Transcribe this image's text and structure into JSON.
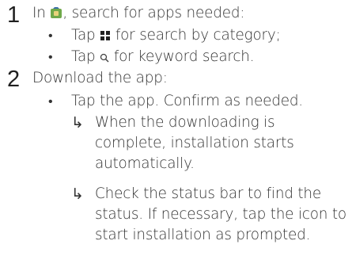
{
  "step1": {
    "number": "1",
    "text_before_icon": "In",
    "text_after_icon": ", search for apps needed:",
    "icon": "app-store-icon",
    "bullets": [
      {
        "before": "Tap",
        "icon": "category-grid-icon",
        "after": "for search by category;"
      },
      {
        "before": "Tap",
        "icon": "search-icon",
        "after": "for keyword search."
      }
    ]
  },
  "step2": {
    "number": "2",
    "text": "Download the app:",
    "bullet": "Tap the app. Confirm as needed.",
    "results": [
      {
        "lines": [
          "When the downloading is",
          "complete, installation starts",
          "automatically."
        ]
      },
      {
        "lines": [
          "Check the status bar to find the",
          "status. If necessary, tap the icon to",
          "start installation as prompted."
        ]
      }
    ]
  },
  "symbols": {
    "bullet": "•",
    "result_arrow": "↳"
  },
  "colors": {
    "text": "#333333",
    "number": "#1f1f1f",
    "app_icon_green": "#6fa84a",
    "app_icon_blue": "#3b6fa8"
  }
}
